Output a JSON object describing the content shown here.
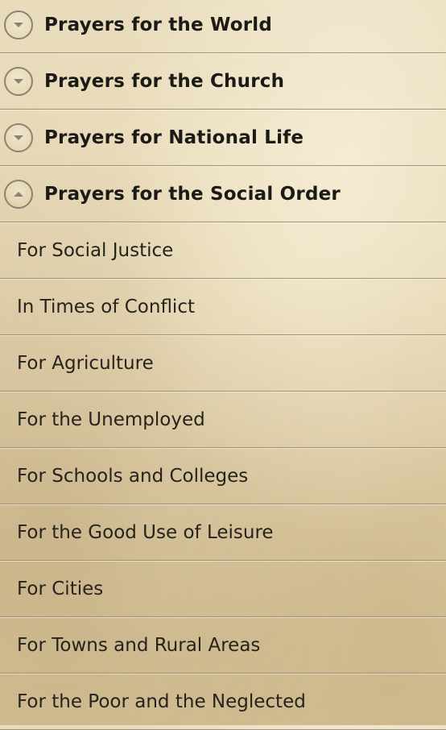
{
  "sections": [
    {
      "label": "Prayers for the World",
      "expanded": false,
      "icon": "chevron-down-icon"
    },
    {
      "label": "Prayers for the Church",
      "expanded": false,
      "icon": "chevron-down-icon"
    },
    {
      "label": "Prayers for National Life",
      "expanded": false,
      "icon": "chevron-down-icon"
    },
    {
      "label": "Prayers for the Social Order",
      "expanded": true,
      "icon": "chevron-up-icon"
    }
  ],
  "items": [
    {
      "label": "For Social Justice"
    },
    {
      "label": "In Times of Conflict"
    },
    {
      "label": "For Agriculture"
    },
    {
      "label": "For the Unemployed"
    },
    {
      "label": "For Schools and Colleges"
    },
    {
      "label": "For the Good Use of Leisure"
    },
    {
      "label": "For Cities"
    },
    {
      "label": "For Towns and Rural Areas"
    },
    {
      "label": "For the Poor and the Neglected"
    }
  ],
  "colors": {
    "text": "#1c1a16",
    "divider": "#9d9178",
    "icon": "#8b8372"
  }
}
